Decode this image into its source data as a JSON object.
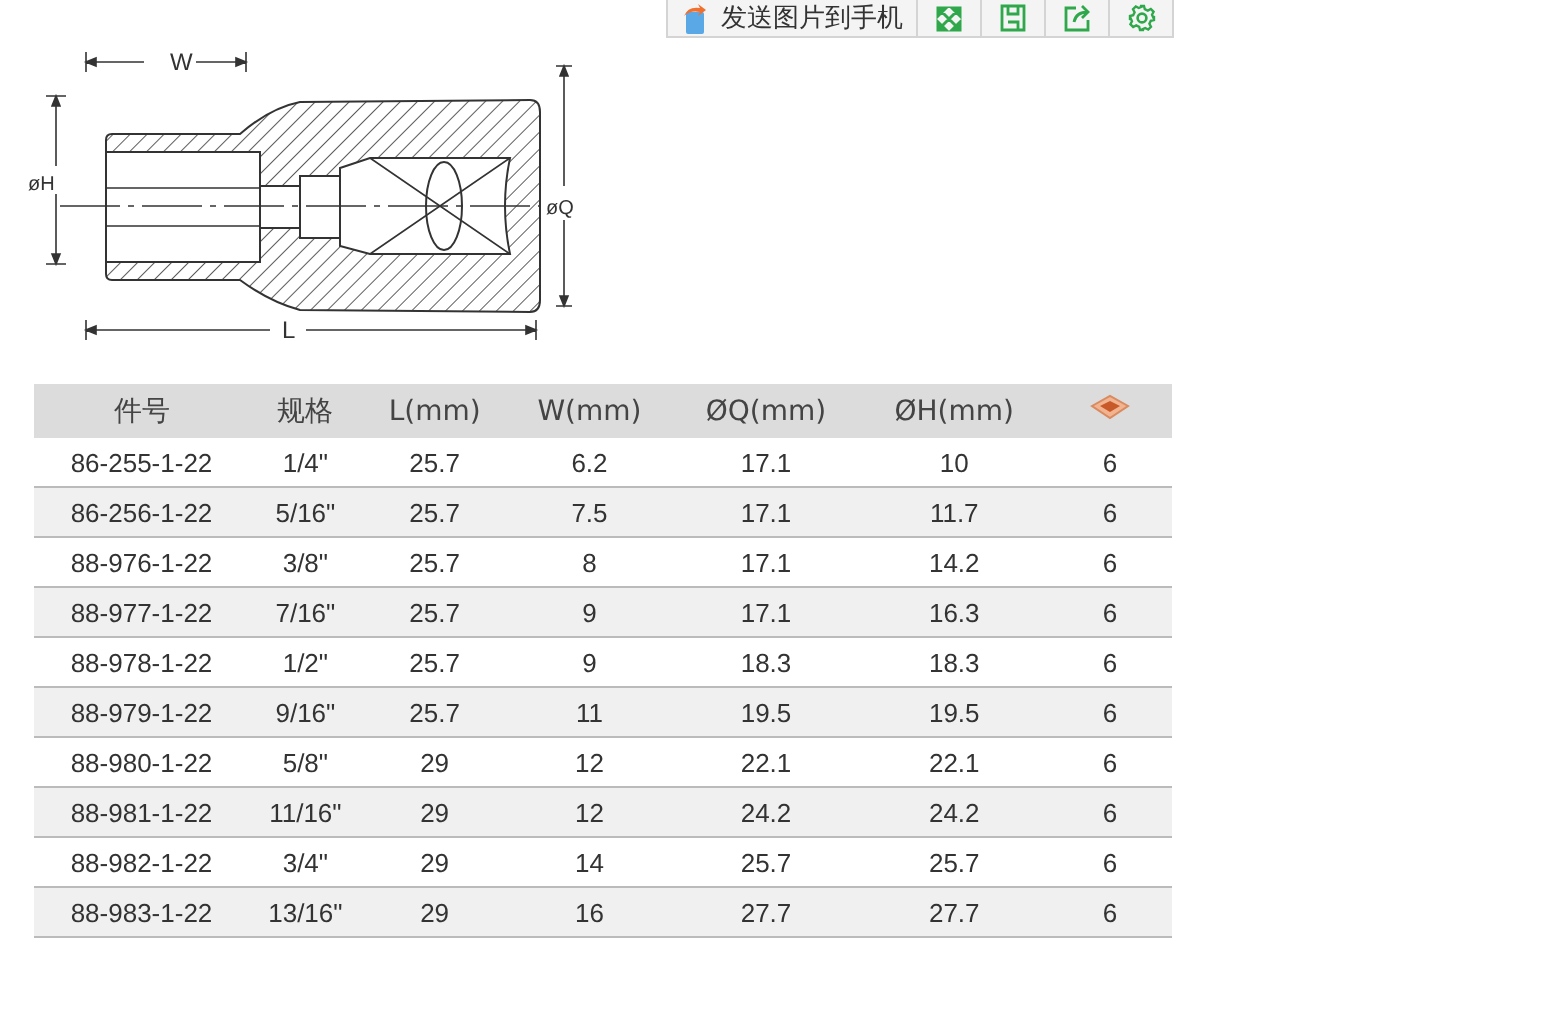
{
  "toolbar": {
    "send_label": "发送图片到手机"
  },
  "drawing": {
    "w_label": "W",
    "h_label": "øH",
    "q_label": "øQ",
    "l_label": "L"
  },
  "table": {
    "columns": [
      "件号",
      "规格",
      "L(mm)",
      "W(mm)",
      "ØQ(mm)",
      "ØH(mm)"
    ],
    "rows": [
      [
        "86-255-1-22",
        "1/4\"",
        "25.7",
        "6.2",
        "17.1",
        "10",
        "6"
      ],
      [
        "86-256-1-22",
        "5/16\"",
        "25.7",
        "7.5",
        "17.1",
        "11.7",
        "6"
      ],
      [
        "88-976-1-22",
        "3/8\"",
        "25.7",
        "8",
        "17.1",
        "14.2",
        "6"
      ],
      [
        "88-977-1-22",
        "7/16\"",
        "25.7",
        "9",
        "17.1",
        "16.3",
        "6"
      ],
      [
        "88-978-1-22",
        "1/2\"",
        "25.7",
        "9",
        "18.3",
        "18.3",
        "6"
      ],
      [
        "88-979-1-22",
        "9/16\"",
        "25.7",
        "11",
        "19.5",
        "19.5",
        "6"
      ],
      [
        "88-980-1-22",
        "5/8\"",
        "29",
        "12",
        "22.1",
        "22.1",
        "6"
      ],
      [
        "88-981-1-22",
        "11/16\"",
        "29",
        "12",
        "24.2",
        "24.2",
        "6"
      ],
      [
        "88-982-1-22",
        "3/4\"",
        "29",
        "14",
        "25.7",
        "25.7",
        "6"
      ],
      [
        "88-983-1-22",
        "13/16\"",
        "29",
        "16",
        "27.7",
        "27.7",
        "6"
      ]
    ]
  }
}
